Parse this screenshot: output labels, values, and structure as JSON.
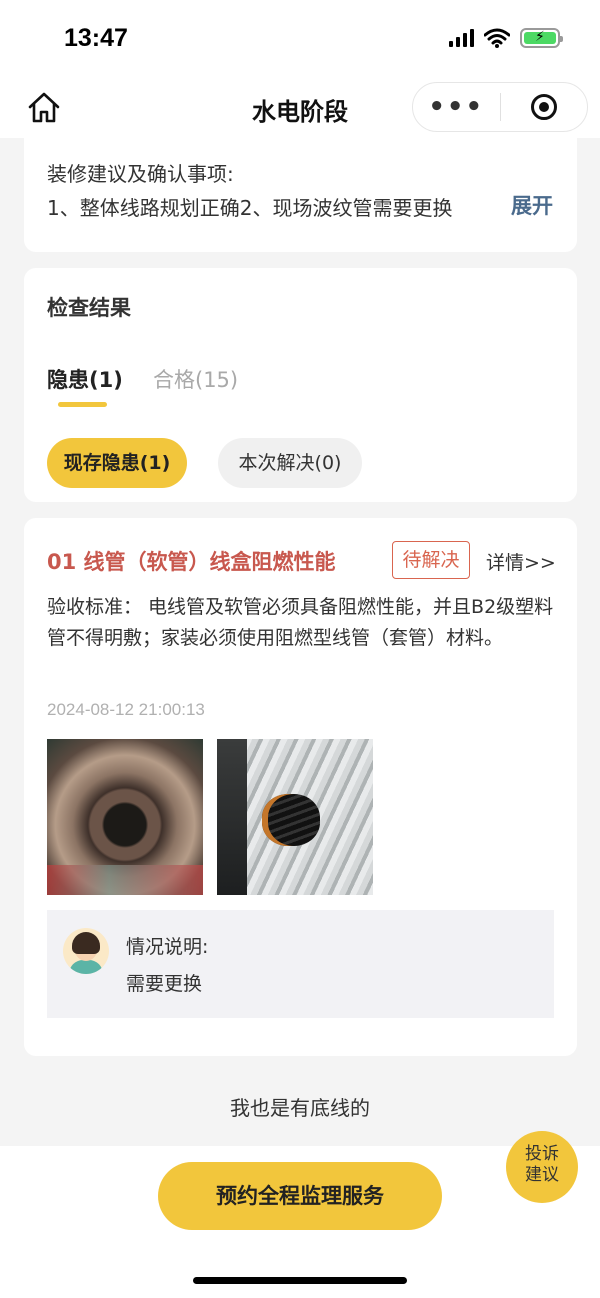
{
  "status_bar": {
    "time": "13:47"
  },
  "nav": {
    "title": "水电阶段",
    "more_label": "•••"
  },
  "suggestion": {
    "label": "装修建议及确认事项:",
    "text": "1、整体线路规划正确2、现场波纹管需要更换",
    "expand_label": "展开"
  },
  "result": {
    "title": "检查结果",
    "tabs": [
      {
        "label": "隐患(1)",
        "active": true
      },
      {
        "label": "合格(15)",
        "active": false
      }
    ],
    "filters": [
      {
        "label": "现存隐患(1)",
        "active": true
      },
      {
        "label": "本次解决(0)",
        "active": false
      }
    ]
  },
  "issue": {
    "title": "01 线管（软管）线盒阻燃性能",
    "status": "待解决",
    "detail_link": "详情>>",
    "standard": "验收标准： 电线管及软管必须具备阻燃性能，并且B2级塑料管不得明敷；家装必须使用阻燃型线管（套管）材料。",
    "time": "2024-08-12 21:00:13",
    "note_label": "情况说明:",
    "note_text": "需要更换"
  },
  "footer": {
    "text": "我也是有底线的"
  },
  "cta": {
    "label": "预约全程监理服务"
  },
  "feedback": {
    "line1": "投诉",
    "line2": "建议"
  },
  "colors": {
    "accent": "#f2c63c",
    "danger": "#d9654f",
    "link": "#4a6a8c"
  }
}
